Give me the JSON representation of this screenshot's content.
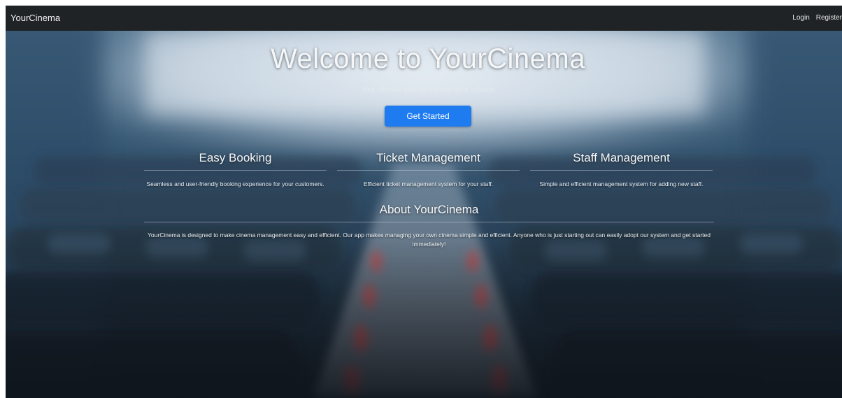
{
  "navbar": {
    "brand": "YourCinema",
    "links": {
      "login": "Login",
      "register": "Register"
    }
  },
  "hero": {
    "title": "Welcome to YourCinema",
    "subtitle": "Your ultimate cinema management solution",
    "cta_label": "Get Started"
  },
  "features": [
    {
      "title": "Easy Booking",
      "text": "Seamless and user-friendly booking experience for your customers."
    },
    {
      "title": "Ticket Management",
      "text": "Efficient ticket management system for your staff."
    },
    {
      "title": "Staff Management",
      "text": "Simple and efficient management system for adding new staff."
    }
  ],
  "about": {
    "title": "About YourCinema",
    "text": "YourCinema is designed to make cinema management easy and efficient. Our app makes managing your own cinema simple and efficient. Anyone who is just starting out can easily adopt our system and get started immediately!"
  },
  "colors": {
    "navbar_bg": "#1f2326",
    "accent": "#1e7cf0",
    "text_light": "#f4f6f8"
  }
}
